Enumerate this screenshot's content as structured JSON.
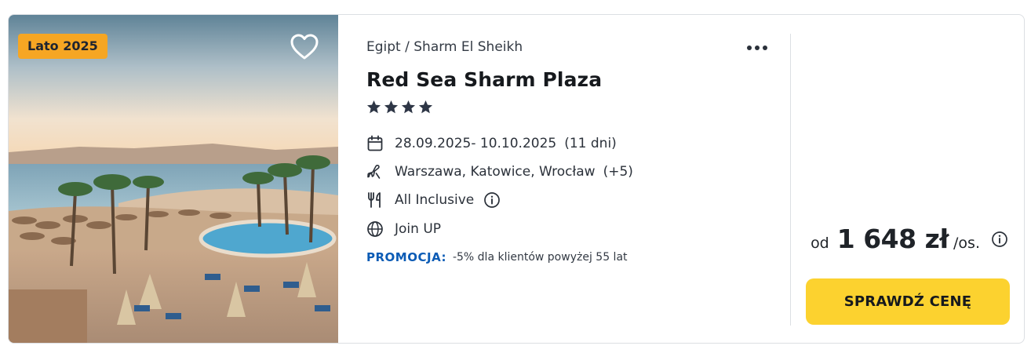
{
  "offer": {
    "badge": "Lato 2025",
    "location": "Egipt / Sharm El Sheikh",
    "hotel_name": "Red Sea Sharm Plaza",
    "stars": 4,
    "dates": "28.09.2025- 10.10.2025",
    "duration": "(11 dni)",
    "airports": "Warszawa, Katowice, Wrocław",
    "airports_more": "(+5)",
    "board": "All Inclusive",
    "program": "Join UP",
    "promo_label": "PROMOCJA:",
    "promo_text": "-5% dla klientów powyżej 55 lat",
    "price_prefix": "od",
    "price_amount": "1 648 zł",
    "price_suffix": "/os.",
    "cta_label": "SPRAWDŹ CENĘ"
  },
  "icons": {
    "favorite": "heart-outline-icon",
    "more": "more-dots-icon",
    "star": "star-icon",
    "dates": "calendar-icon",
    "airports": "plane-icon",
    "board": "cutlery-icon",
    "program": "globe-icon",
    "info": "info-icon"
  },
  "colors": {
    "badge_bg": "#f6a623",
    "cta_bg": "#fcd22f",
    "promo_label": "#0b5bb5",
    "star": "#2e3646"
  }
}
